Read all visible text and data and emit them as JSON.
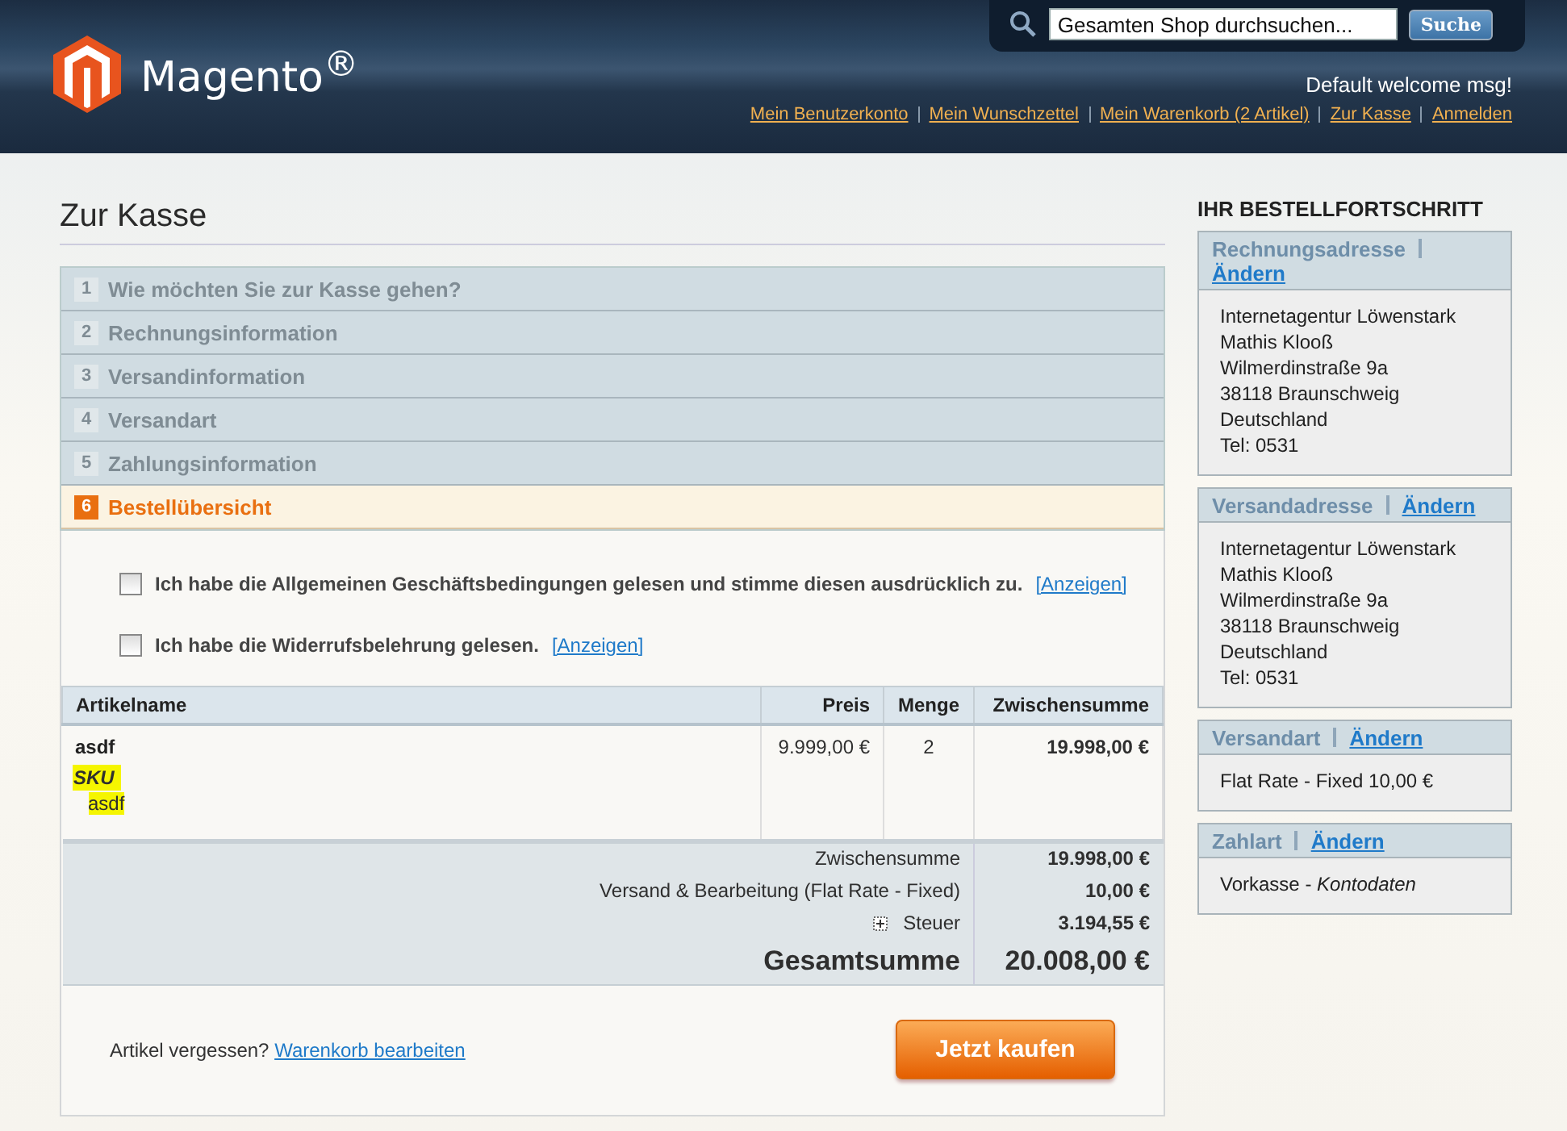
{
  "header": {
    "logo": "Magento$^{®}$",
    "search": {
      "placeholder": "Gesamten Shop durchsuchen...",
      "button": "Suche"
    },
    "welcome": "Default welcome msg!",
    "links": [
      "Mein Benutzerkonto",
      "Mein Wunschzettel",
      "Mein Warenkorb (2 Artikel)",
      "Zur Kasse",
      "Anmelden"
    ]
  },
  "page_title": "Zur Kasse",
  "steps": [
    {
      "number": "1",
      "title": "Wie möchten Sie zur Kasse gehen?",
      "selected": false
    },
    {
      "number": "2",
      "title": "Rechnungsinformation",
      "selected": false
    },
    {
      "number": "3",
      "title": "Versandinformation",
      "selected": false
    },
    {
      "number": "4",
      "title": "Versandart",
      "selected": false
    },
    {
      "number": "5",
      "title": "Zahlungsinformation",
      "selected": false
    },
    {
      "number": "6",
      "title": "Bestellübersicht",
      "selected": true
    }
  ],
  "agreements": [
    {
      "text": "Ich habe die Allgemeinen Geschäftsbedingungen gelesen und stimme diesen ausdrücklich zu.",
      "link": "[Anzeigen]",
      "checked": false
    },
    {
      "text": "Ich habe die Widerrufsbelehrung gelesen.",
      "link": "[Anzeigen]",
      "checked": false
    }
  ],
  "table": {
    "columns": [
      "Artikelname",
      "Preis",
      "Menge",
      "Zwischensumme"
    ],
    "rows": [
      {
        "name": "asdf",
        "option_label": "SKU",
        "option_value": "asdf",
        "price": "9.999,00 €",
        "qty": "2",
        "subtotal": "19.998,00 €"
      }
    ],
    "totals": [
      {
        "label": "Zwischensumme",
        "value": "19.998,00 €",
        "kind": "plain"
      },
      {
        "label": "Versand & Bearbeitung (Flat Rate - Fixed)",
        "value": "10,00 €",
        "kind": "plain"
      },
      {
        "label": "Steuer",
        "value": "3.194,55 €",
        "kind": "expandable"
      },
      {
        "label": "Gesamtsumme",
        "value": "20.008,00 €",
        "kind": "grand"
      }
    ]
  },
  "footer": {
    "text": "Artikel vergessen?",
    "link": "Warenkorb bearbeiten",
    "button": "Jetzt kaufen"
  },
  "progress": {
    "title": "IHR BESTELLFORTSCHRITT",
    "sections": [
      {
        "title": "Rechnungsadresse",
        "link": "Ändern",
        "lines": [
          "Internetagentur Löwenstark",
          "Mathis Klooß",
          "Wilmerdinstraße 9a",
          "38118 Braunschweig",
          "Deutschland",
          "Tel: 0531"
        ]
      },
      {
        "title": "Versandadresse",
        "link": "Ändern",
        "lines": [
          "Internetagentur Löwenstark",
          "Mathis Klooß",
          "Wilmerdinstraße 9a",
          "38118 Braunschweig",
          "Deutschland",
          "Tel: 0531"
        ]
      },
      {
        "title": "Versandart",
        "link": "Ändern",
        "lines": [
          "Flat Rate - Fixed 10,00 €"
        ]
      },
      {
        "title": "Zahlart",
        "link": "Ändern",
        "lines": [
          "Vorkasse - *Kontodaten*"
        ]
      }
    ]
  }
}
